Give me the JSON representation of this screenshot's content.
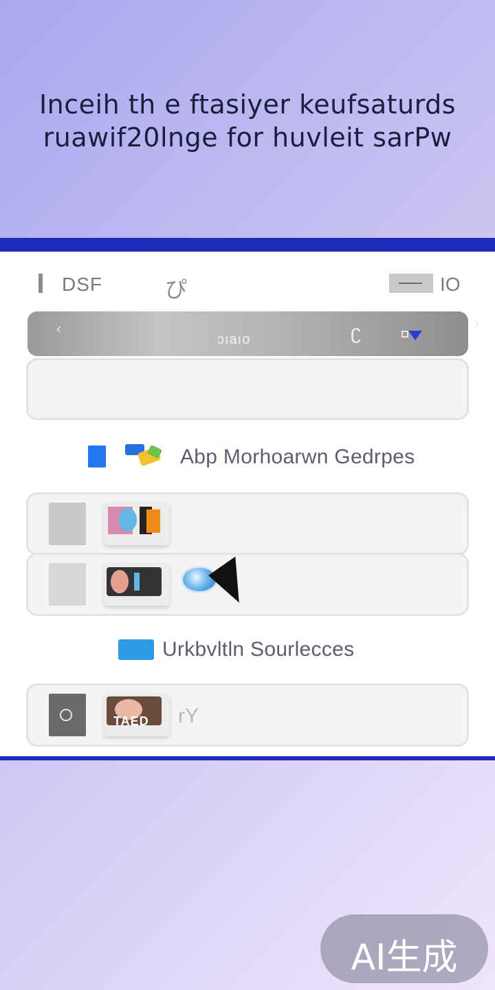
{
  "headline": {
    "line1": "Inceih th e ftasiyer  keufsaturds",
    "line2": "ruawif20lnge for huvleit sarPw"
  },
  "topbar": {
    "title": "DSF",
    "logo": "ぴ",
    "right_label": "IO"
  },
  "search": {
    "back": "‹",
    "forward": "›",
    "label": "ɔıaıo",
    "mic": "ʗ"
  },
  "sections": [
    {
      "label": "Abp Morhoarwn Gedrpes"
    },
    {
      "label": "Urkbvltln Sourlecces"
    }
  ],
  "rows": [
    {
      "thumb_caption": ""
    },
    {
      "thumb_caption": ""
    },
    {
      "thumb_caption": "TAED",
      "suffix": "rY"
    }
  ],
  "watermark": "AI生成",
  "colors": {
    "accent_band": "#1d2bb8",
    "section_icon_blue": "#2277ee",
    "folder_blue": "#2f9be6"
  }
}
